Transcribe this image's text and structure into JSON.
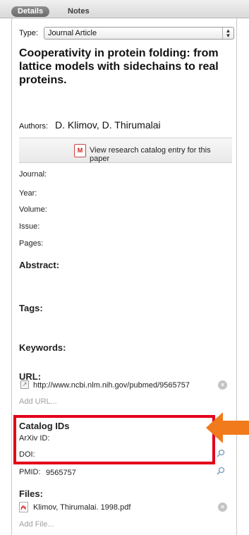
{
  "tabs": {
    "details": "Details",
    "notes": "Notes"
  },
  "type": {
    "label": "Type:",
    "value": "Journal Article"
  },
  "title": "Cooperativity in protein folding: from lattice models with sidechains to real proteins.",
  "authors": {
    "label": "Authors:",
    "value": "D. Klimov, D. Thirumalai"
  },
  "catalog_button": {
    "icon": "mendeley-icon",
    "icon_text": "M",
    "label": "View research catalog entry for this paper"
  },
  "fields": {
    "journal": "Journal:",
    "year": "Year:",
    "volume": "Volume:",
    "issue": "Issue:",
    "pages": "Pages:"
  },
  "sections": {
    "abstract": "Abstract:",
    "tags": "Tags:",
    "keywords": "Keywords:",
    "url": "URL:",
    "catalog_ids": "Catalog IDs",
    "files": "Files:"
  },
  "url": {
    "value": "http://www.ncbi.nlm.nih.gov/pubmed/9565757",
    "add": "Add URL..."
  },
  "catalog_ids": {
    "arxiv": "ArXiv ID:",
    "doi": "DOI:",
    "pmid_label": "PMID:",
    "pmid_value": "9565757"
  },
  "files": {
    "name": "Klimov, Thirumalai. 1998.pdf",
    "add": "Add File..."
  },
  "colors": {
    "highlight_box": "#e3001b",
    "arrow": "#f07a1c"
  }
}
